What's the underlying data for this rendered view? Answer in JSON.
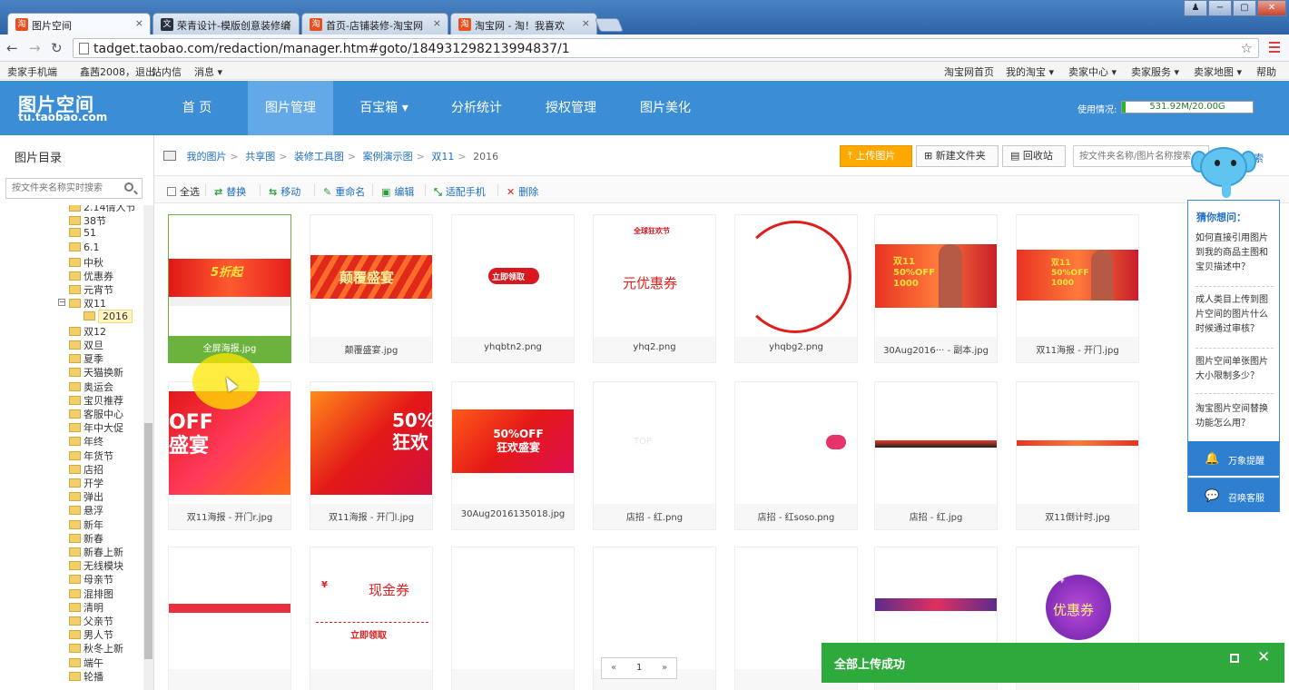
{
  "browser": {
    "tabs": [
      {
        "title": "图片空间",
        "favicon": "淘"
      },
      {
        "title": "荣青设计-模版创意装修编",
        "favicon": "文"
      },
      {
        "title": "首页-店铺装修-淘宝网",
        "favicon": "淘"
      },
      {
        "title": "淘宝网 - 淘！我喜欢",
        "favicon": "淘"
      }
    ],
    "url": "tadget.taobao.com/redaction/manager.htm#goto/184931298213994837/1",
    "window_controls": {
      "user": "♟",
      "minimize": "−",
      "maximize": "▢",
      "close": "✕"
    },
    "tab_close": "×"
  },
  "sitebar": {
    "left": [
      "卖家手机端",
      "鑫茜2008，退出",
      "站内信",
      "消息 ▾"
    ],
    "right": [
      "淘宝网首页",
      "我的淘宝 ▾",
      "卖家中心 ▾",
      "卖家服务 ▾",
      "卖家地图 ▾",
      "帮助"
    ]
  },
  "header": {
    "logo_title": "图片空间",
    "logo_sub": "tu.taobao.com",
    "nav": [
      "首 页",
      "图片管理",
      "百宝箱 ▾",
      "分析统计",
      "授权管理",
      "图片美化"
    ],
    "usage_label": "使用情况:",
    "usage_value": "531.92M/20.00G",
    "usage_fraction": 0.026
  },
  "sidebar": {
    "title": "图片目录",
    "search_placeholder": "按文件夹名称实时搜索",
    "tree": [
      "2.14情人节",
      "38节",
      "51",
      "6.1",
      "中秋",
      "优惠券",
      "元宵节",
      "双11",
      "2016",
      "双12",
      "双旦",
      "夏季",
      "天猫换新",
      "奥运会",
      "宝贝推荐",
      "客服中心",
      "年中大促",
      "年终",
      "年货节",
      "店招",
      "开学",
      "弹出",
      "悬浮",
      "新年",
      "新春",
      "新春上新",
      "无线模块",
      "母亲节",
      "混排图",
      "清明",
      "父亲节",
      "男人节",
      "秋冬上新",
      "端午",
      "轮播"
    ],
    "toggle": "−"
  },
  "content": {
    "breadcrumb": [
      "我的图片",
      "共享图",
      "装修工具图",
      "案例演示图",
      "双11"
    ],
    "breadcrumb_current": "2016",
    "breadcrumb_sep": ">",
    "buttons": {
      "upload": "上传图片",
      "new_folder": "新建文件夹",
      "recycle": "回收站"
    },
    "search_placeholder": "按文件夹名称/图片名称搜索",
    "search_tail": "搜索",
    "toolbar": {
      "select_all": "全选",
      "replace": "替换",
      "move": "移动",
      "rename": "重命名",
      "edit": "编辑",
      "mobile": "适配手机",
      "delete": "删除"
    },
    "toolbar_icons": {
      "replace": "⇄",
      "move": "⇆",
      "rename": "✎",
      "edit": "▣",
      "mobile": "⤡",
      "delete": "✕",
      "upload": "⤒",
      "new_folder": "⊞",
      "recycle": "▤"
    },
    "images": [
      {
        "name": "全屏海报.jpg",
        "banner_text": "5折起"
      },
      {
        "name": "颠覆盛宴.jpg",
        "banner_text": "颠覆盛宴"
      },
      {
        "name": "yhqbtn2.png",
        "banner_text": "立即领取"
      },
      {
        "name": "yhq2.png",
        "banner_text": "元优惠券",
        "logo_text": "全球狂欢节"
      },
      {
        "name": "yhqbg2.png"
      },
      {
        "name": "30Aug2016··· - 副本.jpg",
        "banner_text": "双11 50%OFF 1000"
      },
      {
        "name": "双11海报 - 开门.jpg",
        "banner_text": "双11 50%OFF 1000"
      },
      {
        "name": "双11海报 - 开门r.jpg",
        "banner_text": "OFF 盛宴"
      },
      {
        "name": "双11海报 - 开门l.jpg",
        "banner_text": "50% 狂欢"
      },
      {
        "name": "30Aug2016135018.jpg",
        "banner_text": "50%OFF 狂欢盛宴"
      },
      {
        "name": "店招 - 红.png",
        "banner_text": "TOP"
      },
      {
        "name": "店招 - 红soso.png"
      },
      {
        "name": "店招 - 红.jpg"
      },
      {
        "name": "双11倒计时.jpg"
      },
      {
        "name": ""
      },
      {
        "name": "",
        "banner_text": "现金券",
        "sub_text": "立即领取",
        "currency": "¥"
      },
      {
        "name": ""
      },
      {
        "name": ""
      },
      {
        "name": ""
      },
      {
        "name": ""
      },
      {
        "name": "",
        "banner_text": "优惠券",
        "currency": "¥"
      }
    ],
    "pager": {
      "prev": "«",
      "page": "1",
      "next": "»"
    }
  },
  "helper": {
    "title": "猜你想问：",
    "questions": [
      "如何直接引用图片到我的商品主图和宝贝描述中？",
      "成人类目上传到图片空间的图片什么时候通过审核？",
      "图片空间单张图片大小限制多少？",
      "淘宝图片空间替换功能怎么用？"
    ],
    "btn_remind": "万象提醒",
    "btn_service": "召唤客服",
    "btn_remind_icon": "🔔",
    "btn_service_icon": "💬"
  },
  "toast": {
    "text": "全部上传成功",
    "close": "✕"
  }
}
